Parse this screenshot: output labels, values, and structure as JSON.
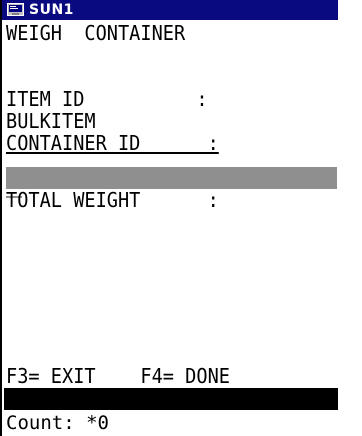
{
  "window": {
    "title": "SUN1",
    "icon": "terminal-window-icon"
  },
  "screen": {
    "heading": "WEIGH  CONTAINER",
    "item_id_label": "ITEM ID          :",
    "item_id_value": "BULKITEM",
    "container_id_label": "CONTAINER ID      :",
    "container_id_value": "",
    "total_weight_label": "TOTAL WEIGHT      :",
    "function_keys": "F3= EXIT    F4= DONE",
    "count_text": "Count: *0"
  },
  "colors": {
    "titlebar": "#0a0a80",
    "input_field": "#8f8f8f",
    "status_bar": "#000000"
  }
}
